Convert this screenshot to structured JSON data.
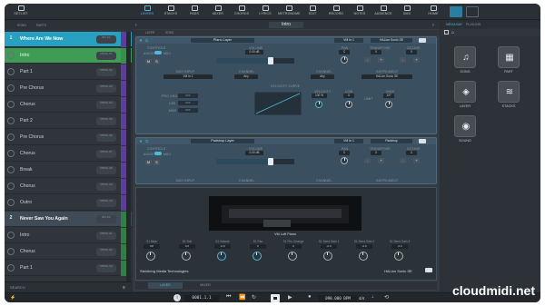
{
  "topbar": {
    "left": [
      {
        "label": "SETLIST",
        "icon": "list-icon"
      }
    ],
    "center": [
      {
        "label": "LAYERS",
        "icon": "layers-icon",
        "active": true
      },
      {
        "label": "STACKS",
        "icon": "stacks-icon"
      },
      {
        "label": "PADS",
        "icon": "pads-icon"
      },
      {
        "label": "MIXER",
        "icon": "mixer-icon"
      },
      {
        "label": "CHORDS",
        "icon": "chords-icon"
      },
      {
        "label": "LYRICS",
        "icon": "lyrics-icon"
      },
      {
        "label": "METRONOME",
        "icon": "metronome-icon"
      },
      {
        "label": "EDIT",
        "icon": "edit-icon"
      },
      {
        "label": "RECORD",
        "icon": "record-icon"
      },
      {
        "label": "NOTES",
        "icon": "notes-icon"
      },
      {
        "label": "AUDIENCE",
        "icon": "audience-icon"
      },
      {
        "label": "DMX",
        "icon": "dmx-icon"
      }
    ],
    "right": [
      {
        "label": "HOME",
        "icon": "home-icon"
      }
    ]
  },
  "setlist": {
    "tabs": [
      "SONG",
      "PARTS"
    ],
    "rows": [
      {
        "kind": "song",
        "num": "1",
        "label": "Where Are We Now",
        "badge": "8th 4/4",
        "state": "selected"
      },
      {
        "kind": "part",
        "label": "Intro",
        "badge": "PROG 01",
        "state": "current"
      },
      {
        "kind": "part",
        "label": "Part 1",
        "badge": "PROG 02"
      },
      {
        "kind": "part",
        "label": "Pre Chorus",
        "badge": "PROG 03"
      },
      {
        "kind": "part",
        "label": "Chorus",
        "badge": "PROG 04"
      },
      {
        "kind": "part",
        "label": "Part 2",
        "badge": "PROG 05"
      },
      {
        "kind": "part",
        "label": "Pre Chorus",
        "badge": "PROG 06"
      },
      {
        "kind": "part",
        "label": "Chorus",
        "badge": "PROG 07"
      },
      {
        "kind": "part",
        "label": "Break",
        "badge": "PROG 08"
      },
      {
        "kind": "part",
        "label": "Chorus",
        "badge": "PROG 09"
      },
      {
        "kind": "part",
        "label": "Outro",
        "badge": "PROG 10"
      },
      {
        "kind": "song",
        "num": "2",
        "label": "Never Saw You Again",
        "badge": "8th 4/4"
      },
      {
        "kind": "part",
        "label": "Intro",
        "badge": "PROG 01"
      },
      {
        "kind": "part",
        "label": "Chorus",
        "badge": "PROG 02"
      },
      {
        "kind": "part",
        "label": "Part 1",
        "badge": "PROG 03"
      }
    ],
    "search": "SEARCH"
  },
  "main": {
    "part_title": "Intro",
    "subtabs": [
      "LAYER",
      "SONG"
    ],
    "layer1": {
      "name": "Piano Layer",
      "vst": "VM In 1",
      "plugin": "HALion Sonic SE",
      "labels": {
        "controls": "CONTROLS",
        "volume": "VOLUME",
        "pan": "PAN",
        "transpose": "TRANSPOSE",
        "octave": "OCTAVE",
        "audio": "AUDIO",
        "midi": "MIDI",
        "midi_input": "MIDI INPUT",
        "channel": "CHANNEL",
        "channel2": "CHANNEL",
        "instrument": "INSTRUMENT",
        "velocity_curve": "VELOCITY CURVE",
        "velocity": "VELOCITY",
        "low": "LOW",
        "limit": "LIMIT",
        "high": "HIGH",
        "prg": "PRG CHG",
        "lsb": "LSB",
        "msb": "MSB"
      },
      "volume_value": "0.00 dB",
      "pan_value": "C",
      "transpose_value": "0",
      "octave_value": "0",
      "midi_input_value": "VM In 1",
      "channel_value": "Any",
      "channel2_value": "Any",
      "instrument_value": "HALion Sonic SE",
      "velocity_value": "100 %",
      "low_value": "0",
      "high_value": "127",
      "off": "OFF",
      "volume_level": 0.7
    },
    "layer2": {
      "name": "Padshop Layer",
      "vst": "VM In 1",
      "plugin": "Padshop",
      "labels": {
        "controls": "CONTROLS",
        "volume": "VOLUME",
        "pan": "PAN",
        "transpose": "TRANSPOSE",
        "octave": "OCTAVE",
        "audio": "AUDIO",
        "midi": "MIDI",
        "midi_input": "MIDI INPUT",
        "channel": "CHANNEL",
        "channel2": "CHANNEL",
        "instrument": "INSTRUMENT"
      },
      "volume_value": "0.00 dB",
      "pan_value": "C",
      "transpose_value": "0",
      "octave_value": "0",
      "volume_level": 0.7
    },
    "instrument_view": {
      "preset": "VM Loft Piano",
      "knobs": [
        {
          "label": "S1 Mute",
          "value": "Off"
        },
        {
          "label": "S1 Sub",
          "value": "0.0"
        },
        {
          "label": "S1 Volume",
          "value": "-0.0"
        },
        {
          "label": "S1 Pan",
          "value": "C"
        },
        {
          "label": "S1 Pro. Change",
          "value": "0"
        },
        {
          "label": "S1 Send Gain 1",
          "value": "-0.0"
        },
        {
          "label": "S1 Send Gain 2",
          "value": "-0.0"
        },
        {
          "label": "S1 Send Gain 3",
          "value": "-0.0"
        }
      ],
      "vendor": "Steinberg Media Technologies",
      "plugin_name": "HALion Sonic SE",
      "tabs": [
        "LAYER",
        "MIXER"
      ]
    }
  },
  "right_panel": {
    "tabs": [
      "MEDIA BAY",
      "PLUG-INS"
    ],
    "tiles": [
      {
        "label": "SONG",
        "icon": "music-note-icon"
      },
      {
        "label": "PART",
        "icon": "part-icon"
      },
      {
        "label": "LAYER",
        "icon": "layer-icon"
      },
      {
        "label": "STACKS",
        "icon": "stacks-icon"
      },
      {
        "label": "SOUND",
        "icon": "sound-icon"
      }
    ]
  },
  "transport": {
    "position": "0001.1.1",
    "tempo": "090.000 BPM",
    "signature": "4/4"
  },
  "watermark": "cloudmidi.net"
}
